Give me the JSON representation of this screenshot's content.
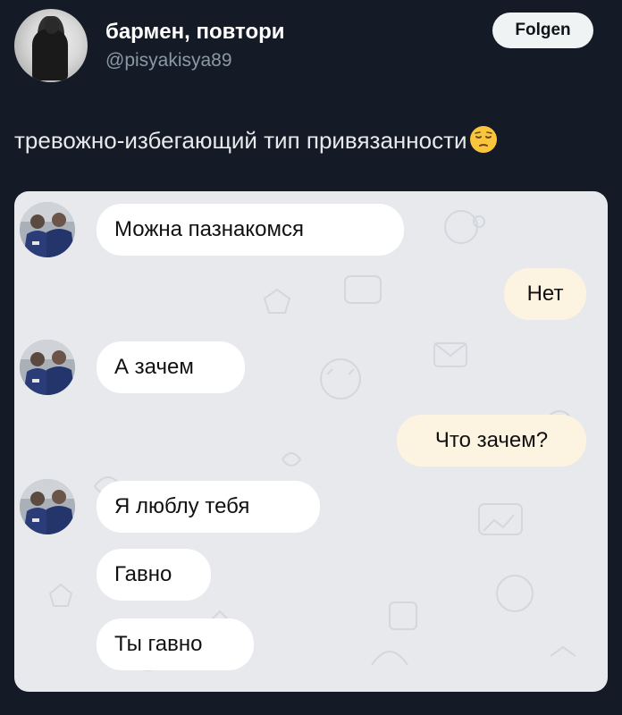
{
  "header": {
    "display_name": "бармен, повтори",
    "handle": "@pisyakisya89",
    "follow_label": "Folgen"
  },
  "tweet": {
    "text": "тревожно-избегающий тип привязанности",
    "emoji": "pensive-face-icon"
  },
  "chat": {
    "messages": [
      {
        "side": "in",
        "text": "Можна пазнакомся",
        "avatar": true
      },
      {
        "side": "out",
        "text": "Нет"
      },
      {
        "side": "in",
        "text": "А зачем",
        "avatar": true
      },
      {
        "side": "out",
        "text": "Что зачем?"
      },
      {
        "side": "in",
        "text": "Я люблу тебя",
        "avatar": true
      },
      {
        "side": "in",
        "text": "Гавно"
      },
      {
        "side": "in",
        "text": "Ты гавно"
      }
    ]
  },
  "colors": {
    "page_bg": "#141b27",
    "incoming_bubble": "#ffffff",
    "outgoing_bubble": "#fdf3e1",
    "chat_bg": "#e7e9ec",
    "follow_bg": "#eff3f4"
  }
}
